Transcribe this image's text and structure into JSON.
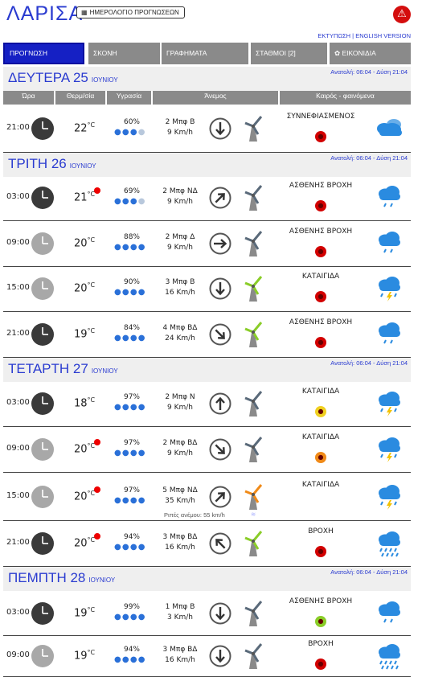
{
  "header": {
    "city": "ΛΑΡΙΣΑ",
    "calendar_button": "ΗΜΕΡΟΛΟΓΙΟ ΠΡΟΓΝΩΣΕΩΝ",
    "print_link": "ΕΚΤΥΠΩΣΗ",
    "separator": "|",
    "english_link": "ENGLISH VERSION"
  },
  "tabs": [
    "ΠΡΟΓΝΩΣΗ",
    "ΣΚΟΝΗ",
    "ΓΡΑΦΗΜΑΤΑ",
    "ΣΤΑΘΜΟΙ [2]",
    "ΕΙΚΟΝΙΔΙΑ"
  ],
  "columns": [
    "Ώρα",
    "Θερμ/σία",
    "Υγρασία",
    "Άνεμος",
    "Καιρός - φαινόμενα"
  ],
  "days": [
    {
      "name": "ΔΕΥΤΕΡΑ 25",
      "month": "ΙΟΥΝΙΟΥ",
      "sun": "Ανατολή: 06:04 - Δύση 21:04"
    },
    {
      "name": "ΤΡΙΤΗ 26",
      "month": "ΙΟΥΝΙΟΥ",
      "sun": "Ανατολή: 06:04 - Δύση 21:04"
    },
    {
      "name": "ΤΕΤΑΡΤΗ 27",
      "month": "ΙΟΥΝΙΟΥ",
      "sun": "Ανατολή: 06:04 - Δύση 21:04"
    },
    {
      "name": "ΠΕΜΠΤΗ 28",
      "month": "ΙΟΥΝΙΟΥ",
      "sun": "Ανατολή: 06:04 - Δύση 21:04"
    }
  ],
  "rows": [
    {
      "time": "21:00",
      "temp": "22",
      "unit": "°C",
      "hot": false,
      "humidity": "60%",
      "drops": 3,
      "wind": "2 Μπφ Β",
      "kmh": "9 Km/h",
      "dir": "down",
      "turbine": "gray",
      "phen": "ΣΥΝΝΕΦΙΑΣΜΕΝΟΣ",
      "warn": "red",
      "icon": "cloudy",
      "clock": "dark"
    },
    {
      "time": "03:00",
      "temp": "21",
      "unit": "°C",
      "hot": true,
      "humidity": "69%",
      "drops": 3,
      "wind": "2 Μπφ ΝΔ",
      "kmh": "9 Km/h",
      "dir": "ne",
      "turbine": "gray",
      "phen": "ΑΣΘΕΝΗΣ ΒΡΟΧΗ",
      "warn": "red",
      "icon": "rain",
      "clock": "dark"
    },
    {
      "time": "09:00",
      "temp": "20",
      "unit": "°C",
      "hot": false,
      "humidity": "88%",
      "drops": 4,
      "wind": "2 Μπφ Δ",
      "kmh": "9 Km/h",
      "dir": "right",
      "turbine": "gray",
      "phen": "ΑΣΘΕΝΗΣ ΒΡΟΧΗ",
      "warn": "red",
      "icon": "rain",
      "clock": "light"
    },
    {
      "time": "15:00",
      "temp": "20",
      "unit": "°C",
      "hot": false,
      "humidity": "90%",
      "drops": 4,
      "wind": "3 Μπφ Β",
      "kmh": "16 Km/h",
      "dir": "down",
      "turbine": "green",
      "phen": "ΚΑΤΑΙΓΙΔΑ",
      "warn": "red",
      "icon": "storm",
      "clock": "light"
    },
    {
      "time": "21:00",
      "temp": "19",
      "unit": "°C",
      "hot": false,
      "humidity": "84%",
      "drops": 4,
      "wind": "4 Μπφ ΒΔ",
      "kmh": "24 Km/h",
      "dir": "se",
      "turbine": "green",
      "phen": "ΑΣΘΕΝΗΣ ΒΡΟΧΗ",
      "warn": "red",
      "icon": "rain",
      "clock": "dark"
    },
    {
      "time": "03:00",
      "temp": "18",
      "unit": "°C",
      "hot": false,
      "humidity": "97%",
      "drops": 4,
      "wind": "2 Μπφ Ν",
      "kmh": "9 Km/h",
      "dir": "up",
      "turbine": "gray",
      "phen": "ΚΑΤΑΙΓΙΔΑ",
      "warn": "yellow",
      "icon": "storm",
      "clock": "dark"
    },
    {
      "time": "09:00",
      "temp": "20",
      "unit": "°C",
      "hot": true,
      "humidity": "97%",
      "drops": 4,
      "wind": "2 Μπφ ΒΔ",
      "kmh": "9 Km/h",
      "dir": "se",
      "turbine": "gray",
      "phen": "ΚΑΤΑΙΓΙΔΑ",
      "warn": "orange",
      "icon": "storm",
      "clock": "light"
    },
    {
      "time": "15:00",
      "temp": "20",
      "unit": "°C",
      "hot": true,
      "humidity": "97%",
      "drops": 4,
      "wind": "5 Μπφ ΝΔ",
      "kmh": "35 Km/h",
      "gust": "Ριπές ανέμου: 55 km/h",
      "dir": "ne",
      "turbine": "orange",
      "phen": "ΚΑΤΑΙΓΙΔΑ",
      "warn": "none",
      "icon": "storm",
      "clock": "light"
    },
    {
      "time": "21:00",
      "temp": "20",
      "unit": "°C",
      "hot": true,
      "humidity": "94%",
      "drops": 4,
      "wind": "3 Μπφ ΒΔ",
      "kmh": "16 Km/h",
      "dir": "nw",
      "turbine": "green",
      "phen": "ΒΡΟΧΗ",
      "warn": "red",
      "icon": "heavyrain",
      "clock": "dark"
    },
    {
      "time": "03:00",
      "temp": "19",
      "unit": "°C",
      "hot": false,
      "humidity": "99%",
      "drops": 4,
      "wind": "1 Μπφ Β",
      "kmh": "3 Km/h",
      "dir": "down",
      "turbine": "gray",
      "phen": "ΑΣΘΕΝΗΣ ΒΡΟΧΗ",
      "warn": "green",
      "icon": "rain",
      "clock": "dark"
    },
    {
      "time": "09:00",
      "temp": "19",
      "unit": "°C",
      "hot": false,
      "humidity": "94%",
      "drops": 4,
      "wind": "3 Μπφ ΒΔ",
      "kmh": "16 Km/h",
      "dir": "down",
      "turbine": "gray",
      "phen": "ΒΡΟΧΗ",
      "warn": "red",
      "icon": "heavyrain",
      "clock": "light"
    }
  ],
  "colors": {
    "accent": "#2a3bd0",
    "tab_active": "#1520c4",
    "tab": "#8a8a8a",
    "day_bg": "#efefef",
    "drop": "#2a70d8",
    "cloud": "#2a8be0",
    "alert": "#d40e0e",
    "warn_red": "#d20000",
    "warn_yellow": "#f0d020",
    "warn_orange": "#f08a18",
    "warn_green": "#8acd28",
    "turbine_green": "#8acd28",
    "turbine_orange": "#f08a18"
  },
  "icons": [
    "calendar-icon",
    "alert-icon",
    "clock-icon",
    "wind-arrow-icon",
    "wind-turbine-icon",
    "warning-icon",
    "weather-icon",
    "gust-icon",
    "picture-icon"
  ]
}
